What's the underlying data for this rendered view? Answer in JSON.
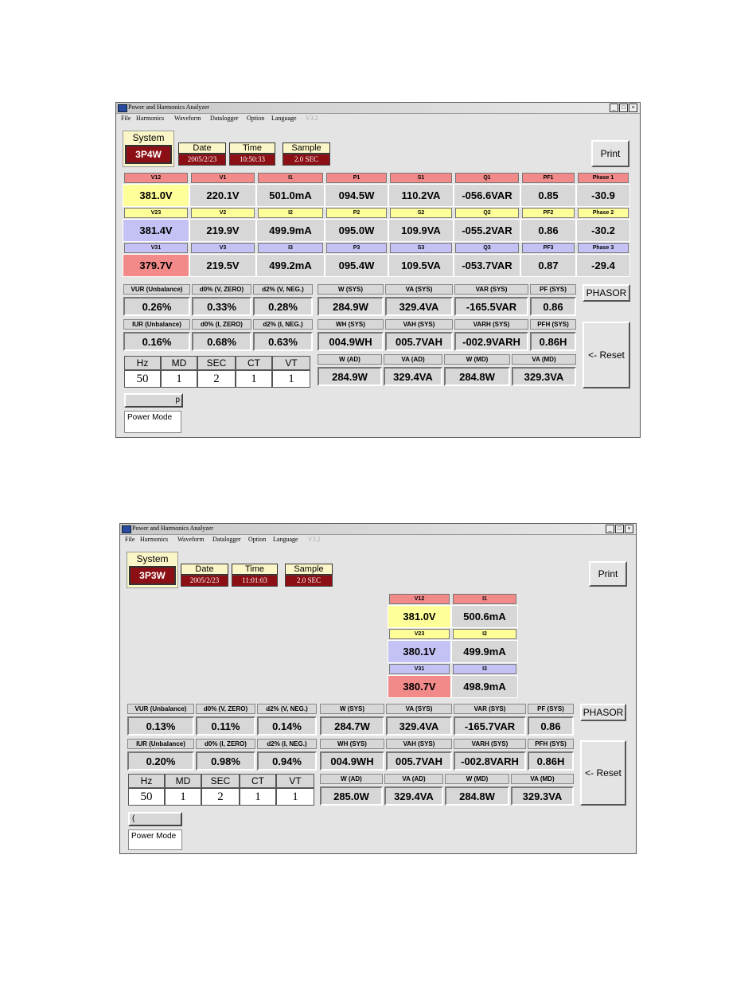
{
  "window1": {
    "title": "Power and Harmonics Analyzer",
    "controls": [
      "_",
      "□",
      "×"
    ],
    "menu": [
      "File",
      "Harmonics",
      "Waveform",
      "Datalogger",
      "Option",
      "Language",
      "V3.2"
    ],
    "system_label": "System",
    "system_value": "3P4W",
    "date_label": "Date",
    "date_value": "2005/2/23",
    "time_label": "Time",
    "time_value": "10:50:33",
    "sample_label": "Sample",
    "sample_value": "2.0 SEC",
    "print": "Print",
    "phasor": "PHASOR",
    "reset": "<- Reset",
    "phase_headers": [
      [
        "V12",
        "V1",
        "I1",
        "P1",
        "S1",
        "Q1",
        "PF1",
        "Phase 1"
      ],
      [
        "V23",
        "V2",
        "I2",
        "P2",
        "S2",
        "Q2",
        "PF2",
        "Phase 2"
      ],
      [
        "V31",
        "V3",
        "I3",
        "P3",
        "S3",
        "Q3",
        "PF3",
        "Phase 3"
      ]
    ],
    "phase_values": [
      [
        "381.0V",
        "220.1V",
        "501.0mA",
        "094.5W",
        "110.2VA",
        "-056.6VAR",
        "0.85",
        "-30.9"
      ],
      [
        "381.4V",
        "219.9V",
        "499.9mA",
        "095.0W",
        "109.9VA",
        "-055.2VAR",
        "0.86",
        "-30.2"
      ],
      [
        "379.7V",
        "219.5V",
        "499.2mA",
        "095.4W",
        "109.5VA",
        "-053.7VAR",
        "0.87",
        "-29.4"
      ]
    ],
    "unbal_labels": [
      [
        "VUR (Unbalance)",
        "d0% (V, ZERO)",
        "d2% (V, NEG.)"
      ],
      [
        "IUR (Unbalance)",
        "d0% (I, ZERO)",
        "d2% (I, NEG.)"
      ]
    ],
    "unbal_values": [
      [
        "0.26%",
        "0.33%",
        "0.28%"
      ],
      [
        "0.16%",
        "0.68%",
        "0.63%"
      ]
    ],
    "settings_labels": [
      "Hz",
      "MD",
      "SEC",
      "CT",
      "VT"
    ],
    "settings_values": [
      "50",
      "1",
      "2",
      "1",
      "1"
    ],
    "sys_labels": [
      [
        "W (SYS)",
        "VA (SYS)",
        "VAR (SYS)",
        "PF (SYS)"
      ],
      [
        "WH (SYS)",
        "VAH (SYS)",
        "VARH (SYS)",
        "PFH (SYS)"
      ],
      [
        "W (AD)",
        "VA (AD)",
        "W (MD)",
        "VA (MD)"
      ]
    ],
    "sys_values": [
      [
        "284.9W",
        "329.4VA",
        "-165.5VAR",
        "0.86"
      ],
      [
        "004.9WH",
        "005.7VAH",
        "-002.9VARH",
        "0.86H"
      ],
      [
        "284.9W",
        "329.4VA",
        "284.8W",
        "329.3VA"
      ]
    ],
    "slider_text": "p",
    "mode": "Power Mode"
  },
  "window2": {
    "title": "Power and Harmonics Analyzer",
    "controls": [
      "_",
      "□",
      "×"
    ],
    "menu": [
      "File",
      "Harmonics",
      "Waveform",
      "Datalogger",
      "Option",
      "Language",
      "V3.2"
    ],
    "system_label": "System",
    "system_value": "3P3W",
    "date_label": "Date",
    "date_value": "2005/2/23",
    "time_label": "Time",
    "time_value": "11:01:03",
    "sample_label": "Sample",
    "sample_value": "2.0 SEC",
    "print": "Print",
    "phasor": "PHASOR",
    "reset": "<- Reset",
    "phase_headers": [
      [
        "V12",
        "I1"
      ],
      [
        "V23",
        "I2"
      ],
      [
        "V31",
        "I3"
      ]
    ],
    "phase_values": [
      [
        "381.0V",
        "500.6mA"
      ],
      [
        "380.1V",
        "499.9mA"
      ],
      [
        "380.7V",
        "498.9mA"
      ]
    ],
    "unbal_labels": [
      [
        "VUR (Unbalance)",
        "d0% (V, ZERO)",
        "d2% (V, NEG.)"
      ],
      [
        "IUR (Unbalance)",
        "d0% (I, ZERO)",
        "d2% (I, NEG.)"
      ]
    ],
    "unbal_values": [
      [
        "0.13%",
        "0.11%",
        "0.14%"
      ],
      [
        "0.20%",
        "0.98%",
        "0.94%"
      ]
    ],
    "settings_labels": [
      "Hz",
      "MD",
      "SEC",
      "CT",
      "VT"
    ],
    "settings_values": [
      "50",
      "1",
      "2",
      "1",
      "1"
    ],
    "sys_labels": [
      [
        "W (SYS)",
        "VA (SYS)",
        "VAR (SYS)",
        "PF (SYS)"
      ],
      [
        "WH (SYS)",
        "VAH (SYS)",
        "VARH (SYS)",
        "PFH (SYS)"
      ],
      [
        "W (AD)",
        "VA (AD)",
        "W (MD)",
        "VA (MD)"
      ]
    ],
    "sys_values": [
      [
        "284.7W",
        "329.4VA",
        "-165.7VAR",
        "0.86"
      ],
      [
        "004.9WH",
        "005.7VAH",
        "-002.8VARH",
        "0.86H"
      ],
      [
        "285.0W",
        "329.4VA",
        "284.8W",
        "329.3VA"
      ]
    ],
    "slider_text": "(",
    "mode": "Power Mode"
  }
}
